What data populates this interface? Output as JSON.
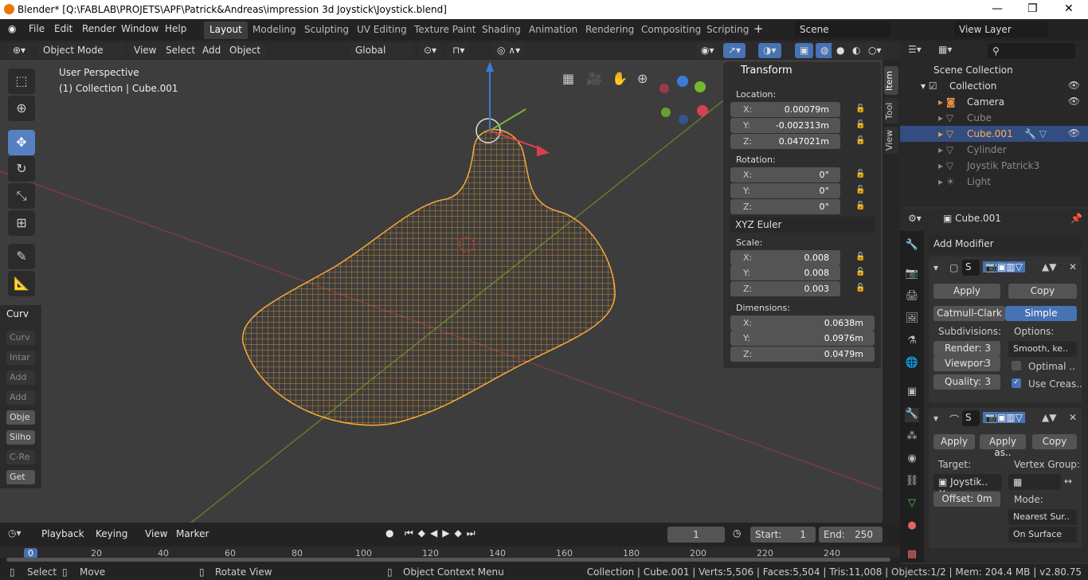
{
  "window": {
    "title": "Blender* [Q:\\FABLAB\\PROJETS\\APF\\Patrick&Andreas\\impression 3d Joystick\\Joystick.blend]"
  },
  "menu": [
    "File",
    "Edit",
    "Render",
    "Window",
    "Help"
  ],
  "workspaces": [
    "Layout",
    "Modeling",
    "Sculpting",
    "UV Editing",
    "Texture Paint",
    "Shading",
    "Animation",
    "Rendering",
    "Compositing",
    "Scripting"
  ],
  "scene": "Scene",
  "view_layer": "View Layer",
  "viewport_header": {
    "mode": "Object Mode",
    "view": "View",
    "select": "Select",
    "add": "Add",
    "object": "Object",
    "orientation": "Global"
  },
  "viewport": {
    "perspective": "User Perspective",
    "collection_info": "(1) Collection | Cube.001"
  },
  "tool_panel": {
    "title": "Curv",
    "buttons": [
      "Curv",
      "Intar",
      "Add",
      "Add",
      "Obje",
      "Silho",
      "C-Re",
      "Get"
    ]
  },
  "npanel": {
    "title": "Transform",
    "location_label": "Location:",
    "location": [
      {
        "k": "X:",
        "v": "0.00079m"
      },
      {
        "k": "Y:",
        "v": "-0.002313m"
      },
      {
        "k": "Z:",
        "v": "0.047021m"
      }
    ],
    "rotation_label": "Rotation:",
    "rotation": [
      {
        "k": "X:",
        "v": "0°"
      },
      {
        "k": "Y:",
        "v": "0°"
      },
      {
        "k": "Z:",
        "v": "0°"
      }
    ],
    "rotation_mode": "XYZ Euler",
    "scale_label": "Scale:",
    "scale": [
      {
        "k": "X:",
        "v": "0.008"
      },
      {
        "k": "Y:",
        "v": "0.008"
      },
      {
        "k": "Z:",
        "v": "0.003"
      }
    ],
    "dimensions_label": "Dimensions:",
    "dimensions": [
      {
        "k": "X:",
        "v": "0.0638m"
      },
      {
        "k": "Y:",
        "v": "0.0976m"
      },
      {
        "k": "Z:",
        "v": "0.0479m"
      }
    ],
    "tabs": [
      "Item",
      "Tool",
      "View"
    ]
  },
  "outliner": {
    "root": "Scene Collection",
    "items": [
      {
        "name": "Collection"
      },
      {
        "name": "Camera"
      },
      {
        "name": "Cube"
      },
      {
        "name": "Cube.001"
      },
      {
        "name": "Cylinder"
      },
      {
        "name": "Joystik Patrick3"
      },
      {
        "name": "Light"
      }
    ]
  },
  "properties": {
    "object": "Cube.001",
    "add_modifier": "Add Modifier",
    "mod1": {
      "name": "S",
      "apply": "Apply",
      "copy": "Copy",
      "type_a": "Catmull-Clark",
      "type_b": "Simple",
      "subdivisions": "Subdivisions:",
      "options": "Options:",
      "render": "Render:",
      "render_v": "3",
      "viewport": "Viewpor:",
      "viewport_v": "3",
      "quality": "Quality:",
      "quality_v": "3",
      "smooth": "Smooth, ke..",
      "optimal": "Optimal ..",
      "use_crease": "Use Creas.."
    },
    "mod2": {
      "name": "S",
      "apply": "Apply",
      "apply_as": "Apply as..",
      "copy": "Copy",
      "target": "Target:",
      "vertex_group": "Vertex Group:",
      "target_v": "Joystik..",
      "offset": "Offset:",
      "offset_v": "0m",
      "mode": "Mode:",
      "mode_v": "Nearest Sur..",
      "on_surface": "On Surface"
    }
  },
  "timeline": {
    "playback": "Playback",
    "keying": "Keying",
    "view": "View",
    "marker": "Marker",
    "frame": "1",
    "start_l": "Start:",
    "start": "1",
    "end_l": "End:",
    "end": "250",
    "ticks": [
      "0",
      "20",
      "40",
      "60",
      "80",
      "100",
      "120",
      "140",
      "160",
      "180",
      "200",
      "220",
      "240"
    ]
  },
  "status": {
    "select": "Select",
    "move": "Move",
    "rotate": "Rotate View",
    "context": "Object Context Menu",
    "info": "Collection | Cube.001 | Verts:5,506 | Faces:5,504 | Tris:11,008 | Objects:1/2 | Mem: 204.4 MB | v2.80.75"
  }
}
